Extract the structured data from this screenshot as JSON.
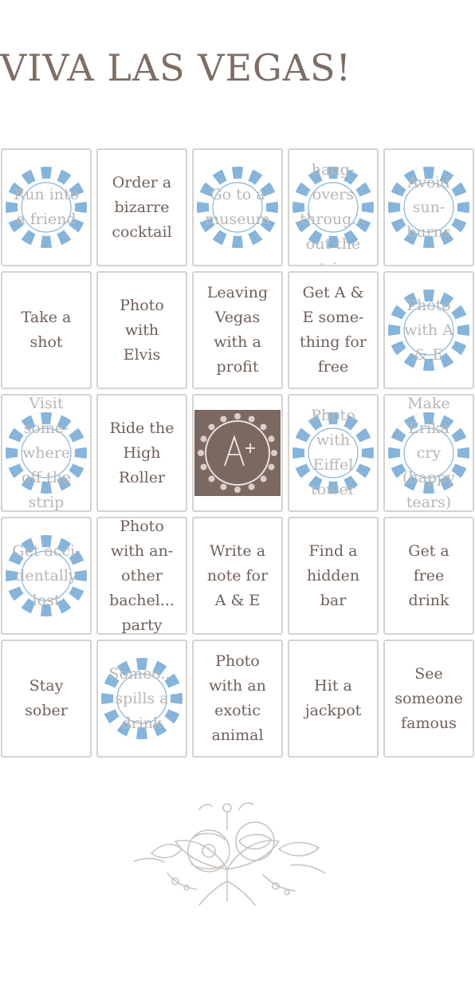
{
  "title": "VIVA LAS VEGAS!",
  "colors": {
    "chip_blue": "#86b4da",
    "tile_brown": "#7b6860",
    "text": "#6f6059",
    "border": "#d6d2cf"
  },
  "board": {
    "rows": [
      [
        {
          "label": "Run into\na friend",
          "marked": true
        },
        {
          "label": "Order a\nbizarre\ncocktail",
          "marked": false
        },
        {
          "label": "Go to a\nmuseum",
          "marked": true
        },
        {
          "label": "Without\nhang-\novers\nthroug...\nout the\ntrip",
          "marked": true
        },
        {
          "label": "Avoid\nsun-\nburns",
          "marked": true
        }
      ],
      [
        {
          "label": "Take a\nshot",
          "marked": false
        },
        {
          "label": "Photo\nwith\nElvis",
          "marked": false
        },
        {
          "label": "Leaving\nVegas\nwith a\nprofit",
          "marked": false
        },
        {
          "label": "Get A &\nE some-\nthing for\nfree",
          "marked": false
        },
        {
          "label": "Photo\nwith A\n& E",
          "marked": true
        }
      ],
      [
        {
          "label": "Visit\nsome-\nwhere\noff the\nstrip",
          "marked": true
        },
        {
          "label": "Ride the\nHigh\nRoller",
          "marked": false
        },
        {
          "label": "",
          "marked": false,
          "free": true,
          "icon": "monogram-tile-icon"
        },
        {
          "label": "Photo\nwith\nEiffel\ntower",
          "marked": true
        },
        {
          "label": "Make\nErika\ncry\n(happy\ntears)",
          "marked": true
        }
      ],
      [
        {
          "label": "Get acci-\ndentally\nlost",
          "marked": true
        },
        {
          "label": "Photo\nwith an-\nother\nbachel...\nparty",
          "marked": false
        },
        {
          "label": "Write a\nnote for\nA & E",
          "marked": false
        },
        {
          "label": "Find a\nhidden\nbar",
          "marked": false
        },
        {
          "label": "Get a\nfree\ndrink",
          "marked": false
        }
      ],
      [
        {
          "label": "Stay\nsober",
          "marked": false
        },
        {
          "label": "Someo...\nspills a\ndrink",
          "marked": true
        },
        {
          "label": "Photo\nwith an\nexotic\nanimal",
          "marked": false
        },
        {
          "label": "Hit a\njackpot",
          "marked": false
        },
        {
          "label": "See\nsomeone\nfamous",
          "marked": false
        }
      ]
    ]
  },
  "decoration": {
    "icon": "floral-bouquet-icon"
  }
}
